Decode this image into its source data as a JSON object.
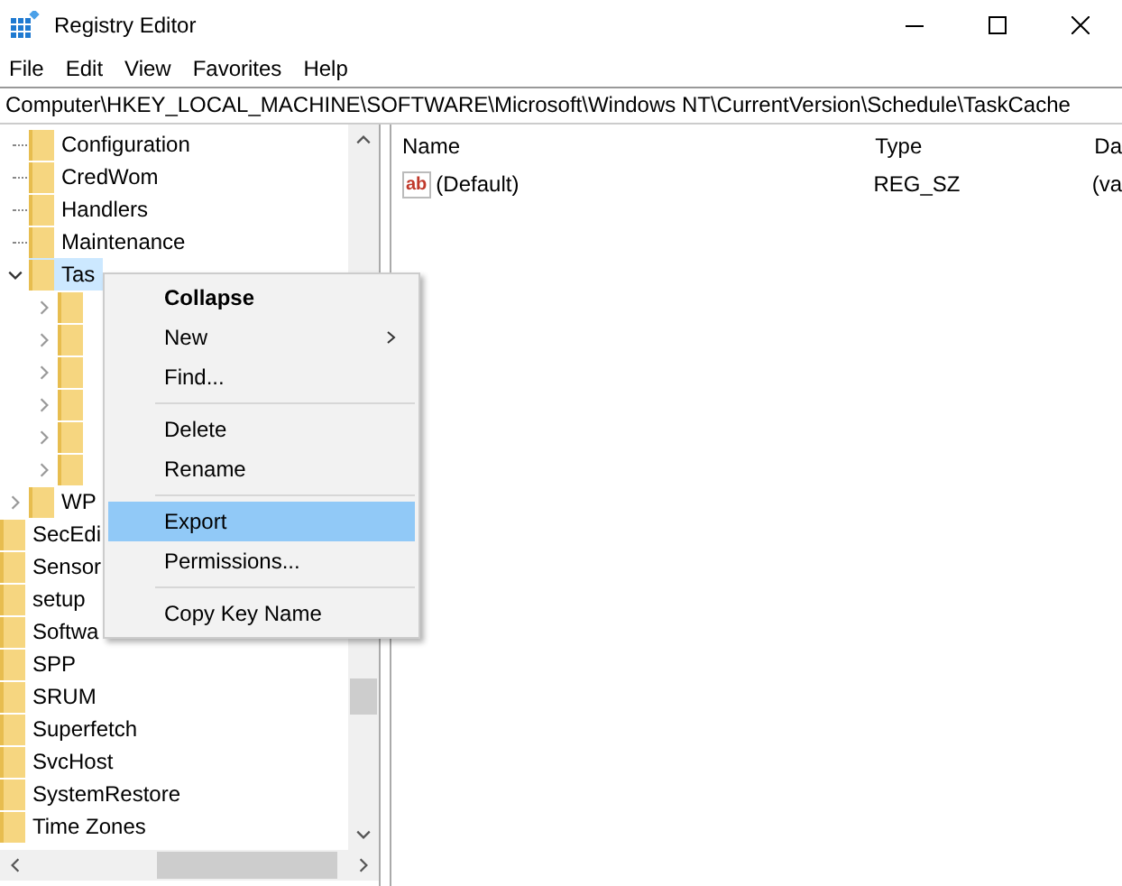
{
  "window": {
    "title": "Registry Editor"
  },
  "menu_bar": [
    "File",
    "Edit",
    "View",
    "Favorites",
    "Help"
  ],
  "address_bar": {
    "value": "Computer\\HKEY_LOCAL_MACHINE\\SOFTWARE\\Microsoft\\Windows NT\\CurrentVersion\\Schedule\\TaskCache"
  },
  "tree": {
    "items": [
      {
        "children": [
          {
            "label": "Configuration",
            "selected": false
          },
          {
            "label": "CredWom",
            "selected": false
          },
          {
            "label": "Handlers",
            "selected": false
          },
          {
            "label": "Maintenance",
            "selected": false
          },
          {
            "label": "Tas",
            "selected": true,
            "expanded": true,
            "children": [
              {
                "expanded": false
              },
              {
                "expanded": false
              },
              {
                "expanded": false
              },
              {
                "expanded": false
              },
              {
                "expanded": false
              },
              {
                "expanded": false
              }
            ]
          },
          {
            "label": "WP",
            "selected": false,
            "expanded": false
          }
        ]
      },
      {
        "label": "SecEdi",
        "selected": false
      },
      {
        "label": "Sensor",
        "selected": false
      },
      {
        "label": "setup",
        "selected": false
      },
      {
        "label": "Softwa",
        "selected": false
      },
      {
        "label": "SPP",
        "selected": false
      },
      {
        "label": "SRUM",
        "selected": false
      },
      {
        "label": "Superfetch",
        "selected": false
      },
      {
        "label": "SvcHost",
        "selected": false
      },
      {
        "label": "SystemRestore",
        "selected": false
      },
      {
        "label": "Time Zones",
        "selected": false
      }
    ]
  },
  "values_table": {
    "columns": [
      "Name",
      "Type",
      "Da"
    ],
    "rows": [
      {
        "icon_text": "ab",
        "name": "(Default)",
        "type": "REG_SZ",
        "data": "(va"
      }
    ]
  },
  "context_menu": {
    "items": [
      {
        "kind": "item",
        "label": "Collapse",
        "default": true,
        "selected": false
      },
      {
        "kind": "submenu",
        "label": "New",
        "selected": false
      },
      {
        "kind": "item",
        "label": "Find...",
        "selected": false
      },
      {
        "kind": "separator"
      },
      {
        "kind": "item",
        "label": "Delete",
        "selected": false
      },
      {
        "kind": "item",
        "label": "Rename",
        "selected": false
      },
      {
        "kind": "separator"
      },
      {
        "kind": "item",
        "label": "Export",
        "selected": true
      },
      {
        "kind": "item",
        "label": "Permissions...",
        "selected": false
      },
      {
        "kind": "separator"
      },
      {
        "kind": "item",
        "label": "Copy Key Name",
        "selected": false
      }
    ]
  }
}
